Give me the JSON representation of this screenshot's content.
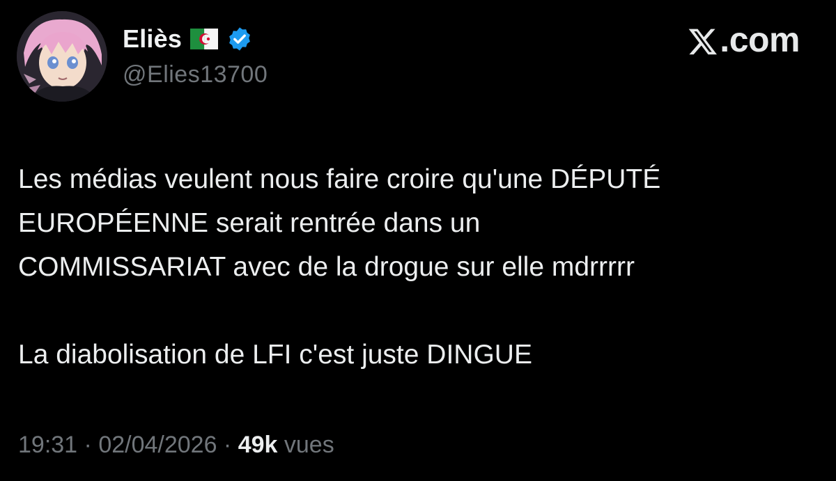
{
  "author": {
    "display_name": "Eliès",
    "handle": "@Elies13700",
    "flag_icon": "algeria-flag-icon",
    "verified_icon": "verified-badge-icon",
    "verified_color": "#1d9bf0",
    "avatar": "anime-avatar"
  },
  "brand": {
    "label": ".com",
    "logo_icon": "x-logo-icon"
  },
  "tweet": {
    "lines": [
      "Les médias veulent nous faire croire qu'une DÉPUTÉ",
      "EUROPÉENNE serait rentrée dans un",
      "COMMISSARIAT avec de la drogue sur elle mdrrrrr"
    ],
    "paragraph_2": "La diabolisation de LFI c'est juste DINGUE"
  },
  "meta": {
    "time": "19:31",
    "separator": " · ",
    "date": "02/04/2026",
    "views_count": "49k",
    "views_label": " vues"
  },
  "colors": {
    "background": "#000000",
    "text": "#e7e9ea",
    "secondary": "#71767b"
  }
}
